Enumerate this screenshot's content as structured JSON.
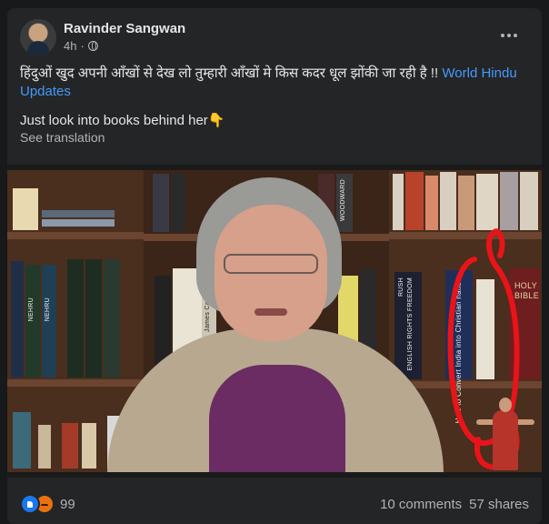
{
  "post": {
    "author": "Ravinder Sangwan",
    "time": "4h",
    "time_sep": "·",
    "text_hindi": "हिंदुओं खुद अपनी आँखों से देख लो तुम्हारी आँखों मे किस कदर धूल झोंकी जा रही है !!",
    "text_link": "World Hindu Updates",
    "text_english": "Just look into books behind her👇",
    "see_translation": "See translation"
  },
  "photo": {
    "book_titles": {
      "nehru_1": "NEHRU",
      "nehru_2": "NEHRU",
      "james": "James Calg",
      "woodward": "WOODWARD",
      "mahatma": "GANDHI",
      "rush": "RUSH",
      "english": "ENGLISH RIGHTS FREEDOM",
      "convert": "How to Convert India into Christian nation",
      "holy": "HOLY BIBLE"
    }
  },
  "footer": {
    "reaction_count": "99",
    "comments": "10 comments",
    "shares": "57 shares"
  },
  "icons": {
    "more": "more-options-icon",
    "globe": "globe-icon",
    "like": "like-reaction-icon",
    "angry": "angry-reaction-icon"
  }
}
